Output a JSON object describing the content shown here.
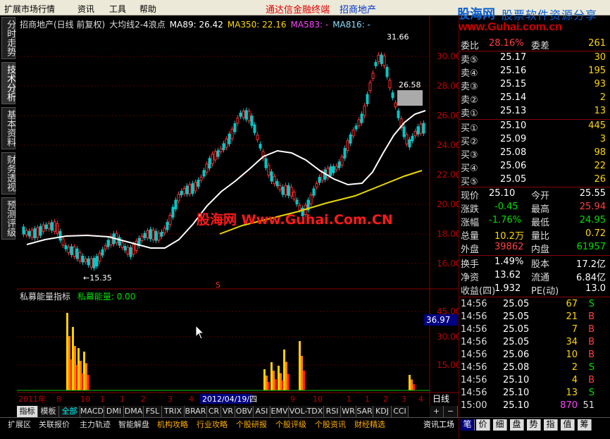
{
  "menubar": {
    "items": [
      "扩展市场行情",
      "资讯",
      "工具",
      "帮助"
    ],
    "app_title": "通达信金融终端",
    "broker": "招商地产"
  },
  "watermark": {
    "name": "股海网",
    "slogan": "股票软件资源分享",
    "url": "www.Guhai.com.cn",
    "overlay": "股海网 Www.Guhai.Com.CN"
  },
  "vtabs": [
    "分时走势",
    "技术分析",
    "基本资料",
    "财务透视",
    "预测评级"
  ],
  "chart_header": {
    "stock": "招商地产(日线 前复权)",
    "indicator": "大均线2-4浪点",
    "ma89": "MA89: 26.42",
    "ma350": "MA350: 22.16",
    "ma583": "MA583: -",
    "ma816": "MA816: -"
  },
  "price_axis": [
    "30.00",
    "28.00",
    "26.00",
    "24.00",
    "22.00",
    "20.00",
    "18.00",
    "16.00"
  ],
  "annotations": {
    "high": "31.66",
    "low": "←15.35",
    "current": "26.58",
    "marker": "S"
  },
  "sub_header": {
    "name": "私募能量指标",
    "value_label": "私幕能量: 0.00"
  },
  "sub_axis": [
    "45.00",
    "30.00",
    "15.00"
  ],
  "sub_current": "36.97",
  "time_axis": {
    "labels": [
      "2011年",
      "8",
      "10",
      "1",
      "1",
      "2",
      "3",
      "4"
    ],
    "selected": "2012/04/19/四",
    "labels2": [
      "7",
      "8",
      "9",
      "10",
      "1",
      "1",
      "2",
      "3",
      "4"
    ],
    "period": "日线"
  },
  "bottom_tabs": [
    "指标",
    "模板",
    "全部",
    "MACD",
    "DMI",
    "DMA",
    "FSL",
    "TRIX",
    "BRAR",
    "CR",
    "VR",
    "OBV",
    "ASI",
    "EMV",
    "VOL-TDX",
    "RSI",
    "WR",
    "SAR",
    "KDJ",
    "CCI"
  ],
  "status_tabs": [
    "扩展区",
    "关联报价",
    "主力轨迹",
    "智能解盘",
    "机构攻略",
    "行业攻略",
    "个股研报",
    "个股评级",
    "个股资讯",
    "财经精选",
    "资讯工场"
  ],
  "right_tabs": [
    "笔",
    "价",
    "细",
    "盘",
    "势",
    "指",
    "值",
    "筹"
  ],
  "quote": {
    "weibi": {
      "label": "委比",
      "pct": "28.16%",
      "label2": "委差",
      "val": "261"
    },
    "sells": [
      {
        "label": "卖⑤",
        "price": "25.17",
        "vol": "30"
      },
      {
        "label": "卖④",
        "price": "25.16",
        "vol": "195"
      },
      {
        "label": "卖③",
        "price": "25.15",
        "vol": "93"
      },
      {
        "label": "卖②",
        "price": "25.14",
        "vol": "2"
      },
      {
        "label": "卖①",
        "price": "25.13",
        "vol": "13"
      }
    ],
    "buys": [
      {
        "label": "买①",
        "price": "25.10",
        "vol": "445"
      },
      {
        "label": "买②",
        "price": "25.09",
        "vol": "3"
      },
      {
        "label": "买③",
        "price": "25.08",
        "vol": "98"
      },
      {
        "label": "买④",
        "price": "25.06",
        "vol": "22"
      },
      {
        "label": "买⑤",
        "price": "25.05",
        "vol": "26"
      }
    ],
    "stats": [
      {
        "l1": "现价",
        "v1": "25.10",
        "l2": "今开",
        "v2": "25.55"
      },
      {
        "l1": "涨跌",
        "v1": "-0.45",
        "l2": "最高",
        "v2": "25.94"
      },
      {
        "l1": "涨幅",
        "v1": "-1.76%",
        "l2": "最低",
        "v2": "24.95"
      },
      {
        "l1": "总量",
        "v1": "10.2万",
        "l2": "量比",
        "v2": "0.72"
      },
      {
        "l1": "外盘",
        "v1": "39862",
        "l2": "内盘",
        "v2": "61957"
      }
    ],
    "stats2": [
      {
        "l1": "换手",
        "v1": "1.49%",
        "l2": "股本",
        "v2": "17.2亿"
      },
      {
        "l1": "净资",
        "v1": "13.62",
        "l2": "流通",
        "v2": "6.84亿"
      },
      {
        "l1": "收益(四)",
        "v1": "1.932",
        "l2": "PE(动)",
        "v2": "13.0"
      }
    ],
    "ticks": [
      {
        "t": "14:56",
        "p": "25.05",
        "v": "67",
        "s": "S"
      },
      {
        "t": "14:56",
        "p": "25.05",
        "v": "21",
        "s": "B"
      },
      {
        "t": "14:56",
        "p": "25.05",
        "v": "7",
        "s": "B"
      },
      {
        "t": "14:56",
        "p": "25.05",
        "v": "34",
        "s": "B"
      },
      {
        "t": "14:56",
        "p": "25.06",
        "v": "10",
        "s": "B"
      },
      {
        "t": "14:56",
        "p": "25.08",
        "v": "2",
        "s": "S"
      },
      {
        "t": "14:56",
        "p": "25.10",
        "v": "4",
        "s": "B"
      },
      {
        "t": "14:56",
        "p": "25.10",
        "v": "13",
        "s": "S"
      },
      {
        "t": "15:00",
        "p": "25.10",
        "v": "870",
        "s": "51"
      }
    ]
  }
}
